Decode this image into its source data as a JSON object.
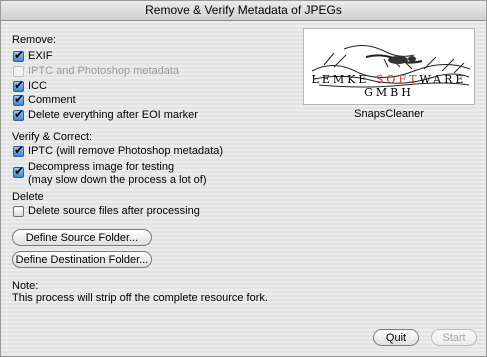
{
  "window": {
    "title": "Remove & Verify Metadata of JPEGs"
  },
  "remove": {
    "label": "Remove:",
    "items": [
      {
        "label": "EXIF",
        "checked": true,
        "enabled": true
      },
      {
        "label": "IPTC and Photoshop metadata",
        "checked": false,
        "enabled": false
      },
      {
        "label": "ICC",
        "checked": true,
        "enabled": true
      },
      {
        "label": "Comment",
        "checked": true,
        "enabled": true
      },
      {
        "label": "Delete everything after EOI marker",
        "checked": true,
        "enabled": true
      }
    ]
  },
  "verify": {
    "label": "Verify & Correct:",
    "items": [
      {
        "label": "IPTC (will remove Photoshop metadata)",
        "checked": true,
        "enabled": true
      },
      {
        "label": "Decompress image for testing",
        "label2": "(may slow down the process a lot of)",
        "checked": true,
        "enabled": true
      }
    ]
  },
  "delete": {
    "label": "Delete",
    "items": [
      {
        "label": "Delete source files after processing",
        "checked": false,
        "enabled": true
      }
    ]
  },
  "buttons": {
    "source": "Define Source Folder...",
    "destination": "Define Destination Folder...",
    "quit": "Quit",
    "start": "Start"
  },
  "logo": {
    "part1": "LEMKE ",
    "part2": "SOFT",
    "part3": "WARE GMBH",
    "caption": "SnapsCleaner"
  },
  "note": {
    "label": "Note:",
    "text": "This process will strip off the complete resource fork."
  }
}
